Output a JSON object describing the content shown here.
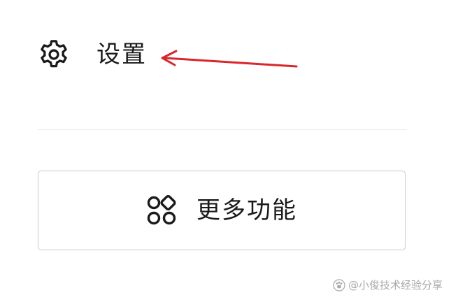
{
  "settings": {
    "label": "设置",
    "icon": "gear-icon"
  },
  "more_features": {
    "label": "更多功能",
    "icon": "grid-icon"
  },
  "watermark": {
    "text": "@小俊技术经验分享",
    "icon": "paw-icon"
  },
  "colors": {
    "text": "#1a1a1a",
    "arrow": "#d9262b",
    "border": "#c9c9c9",
    "divider": "#ebebeb"
  }
}
